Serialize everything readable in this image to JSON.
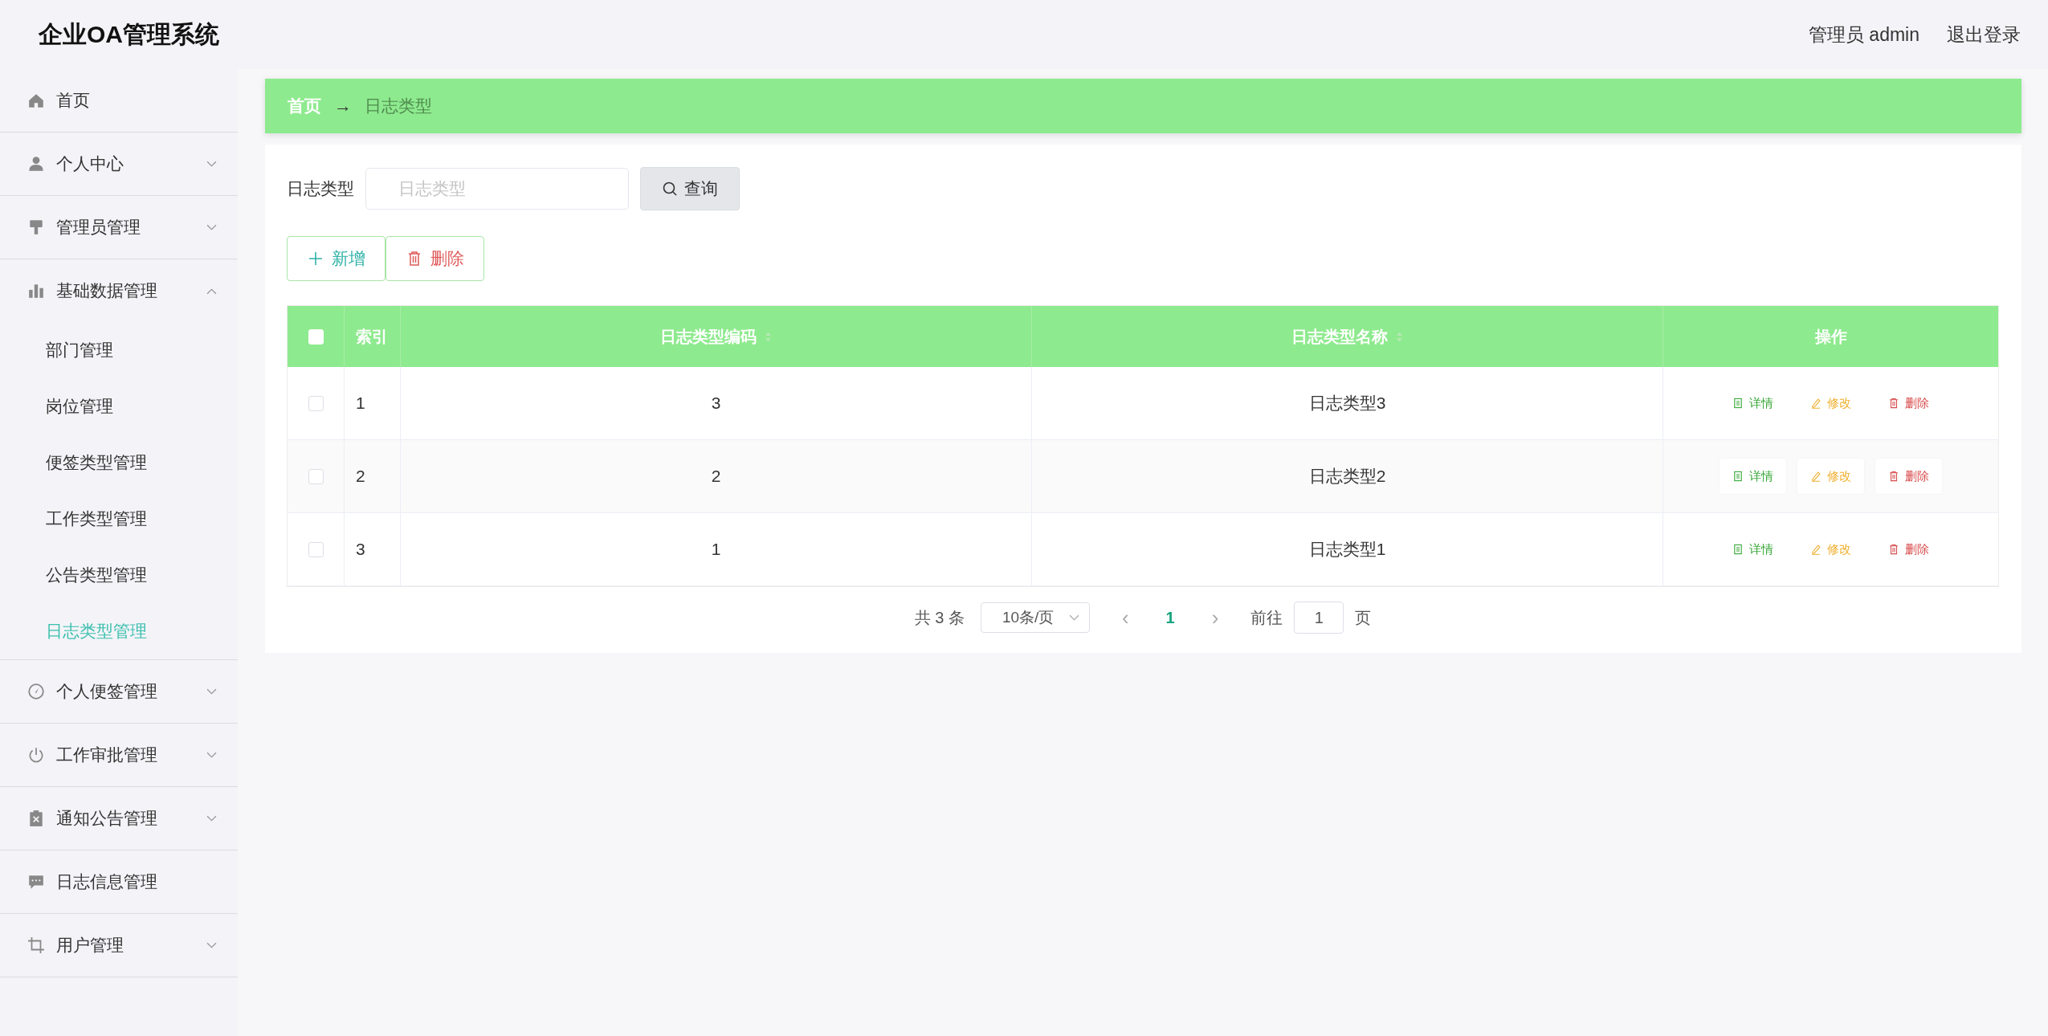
{
  "header": {
    "title": "企业OA管理系统",
    "user": "管理员 admin",
    "logout": "退出登录"
  },
  "sidebar": {
    "items": [
      {
        "label": "首页",
        "kind": "link"
      },
      {
        "label": "个人中心",
        "kind": "submenu",
        "expanded": false
      },
      {
        "label": "管理员管理",
        "kind": "submenu",
        "expanded": false
      },
      {
        "label": "基础数据管理",
        "kind": "submenu",
        "expanded": true,
        "children": [
          {
            "label": "部门管理",
            "selected": false
          },
          {
            "label": "岗位管理",
            "selected": false
          },
          {
            "label": "便签类型管理",
            "selected": false
          },
          {
            "label": "工作类型管理",
            "selected": false
          },
          {
            "label": "公告类型管理",
            "selected": false
          },
          {
            "label": "日志类型管理",
            "selected": true
          }
        ]
      },
      {
        "label": "个人便签管理",
        "kind": "submenu",
        "expanded": false
      },
      {
        "label": "工作审批管理",
        "kind": "submenu",
        "expanded": false
      },
      {
        "label": "通知公告管理",
        "kind": "submenu",
        "expanded": false
      },
      {
        "label": "日志信息管理",
        "kind": "link"
      },
      {
        "label": "用户管理",
        "kind": "submenu",
        "expanded": false
      }
    ]
  },
  "breadcrumb": {
    "home": "首页",
    "separator": "→",
    "current": "日志类型"
  },
  "search": {
    "label": "日志类型",
    "placeholder": "日志类型",
    "button": "查询"
  },
  "actions": [
    {
      "kind": "add",
      "label": "新增"
    },
    {
      "kind": "delete",
      "label": "删除"
    }
  ],
  "table": {
    "select_all_checked": false,
    "columns": [
      {
        "label": "索引",
        "sortable": false
      },
      {
        "label": "日志类型编码",
        "sortable": true
      },
      {
        "label": "日志类型名称",
        "sortable": true
      },
      {
        "label": "操作",
        "sortable": false
      }
    ],
    "rows": [
      {
        "checked": false,
        "cells": [
          "1",
          "3",
          "日志类型3"
        ],
        "actions": [
          {
            "kind": "detail",
            "label": "详情"
          },
          {
            "kind": "edit",
            "label": "修改"
          },
          {
            "kind": "delete",
            "label": "删除"
          }
        ]
      },
      {
        "checked": false,
        "cells": [
          "2",
          "2",
          "日志类型2"
        ],
        "actions": [
          {
            "kind": "detail",
            "label": "详情"
          },
          {
            "kind": "edit",
            "label": "修改"
          },
          {
            "kind": "delete",
            "label": "删除"
          }
        ]
      },
      {
        "checked": false,
        "cells": [
          "3",
          "1",
          "日志类型1"
        ],
        "actions": [
          {
            "kind": "detail",
            "label": "详情"
          },
          {
            "kind": "edit",
            "label": "修改"
          },
          {
            "kind": "delete",
            "label": "删除"
          }
        ]
      }
    ]
  },
  "pagination": {
    "total": "共 3 条",
    "page_size": "10条/页",
    "prev": "‹",
    "pages": [
      {
        "label": "1",
        "selected": true
      }
    ],
    "next": "›",
    "goto_label": "前往",
    "goto_value": "1",
    "goto_suffix": "页"
  }
}
